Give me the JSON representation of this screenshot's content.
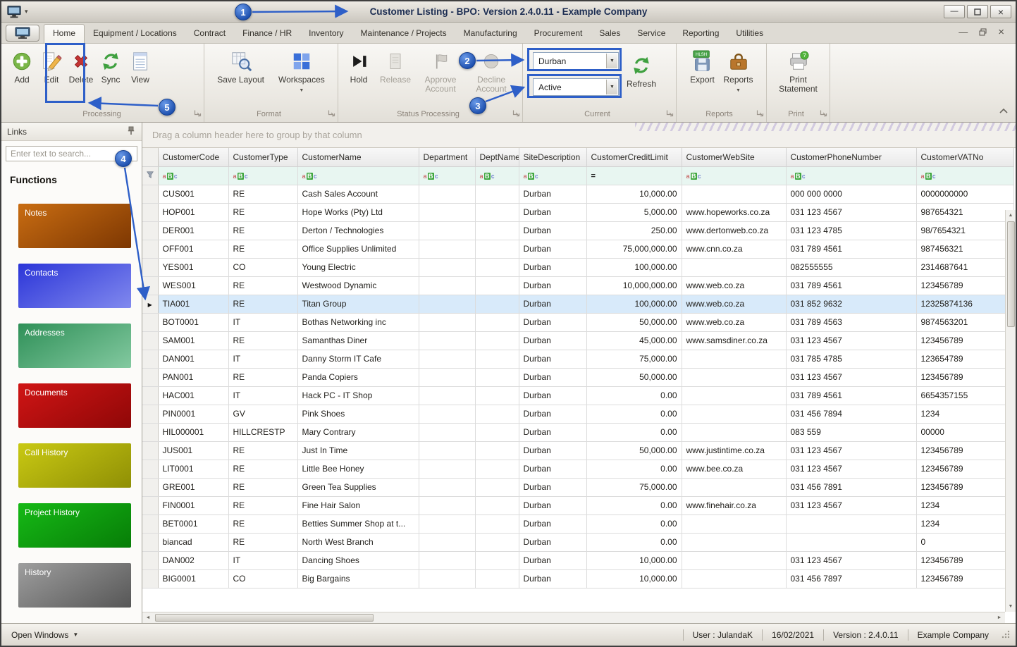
{
  "window": {
    "title": "Customer Listing - BPO: Version 2.4.0.11 - Example Company"
  },
  "ribbon": {
    "tabs": [
      "Home",
      "Equipment / Locations",
      "Contract",
      "Finance / HR",
      "Inventory",
      "Maintenance / Projects",
      "Manufacturing",
      "Procurement",
      "Sales",
      "Service",
      "Reporting",
      "Utilities"
    ],
    "active_tab_index": 0,
    "groups": {
      "processing": {
        "label": "Processing",
        "buttons": {
          "add": "Add",
          "edit": "Edit",
          "delete": "Delete",
          "sync": "Sync",
          "view": "View"
        }
      },
      "format": {
        "label": "Format",
        "buttons": {
          "save_layout": "Save Layout",
          "workspaces": "Workspaces"
        }
      },
      "status_processing": {
        "label": "Status Processing",
        "buttons": {
          "hold": "Hold",
          "release": "Release",
          "approve": "Approve Account",
          "decline": "Decline Account"
        }
      },
      "current": {
        "label": "Current",
        "site_filter": "Durban",
        "status_filter": "Active",
        "refresh": "Refresh"
      },
      "reports": {
        "label": "Reports",
        "buttons": {
          "export": "Export",
          "reports": "Reports"
        },
        "export_badge": "HLSH"
      },
      "print": {
        "label": "Print",
        "buttons": {
          "print_statement": "Print Statement"
        }
      }
    }
  },
  "sidebar": {
    "title": "Links",
    "search_placeholder": "Enter text to search...",
    "section_header": "Functions",
    "items": [
      {
        "label": "Notes",
        "color_from": "#c96d12",
        "color_to": "#7d3702"
      },
      {
        "label": "Contacts",
        "color_from": "#2b35d8",
        "color_to": "#8189ee"
      },
      {
        "label": "Addresses",
        "color_from": "#2f9058",
        "color_to": "#83c9a0"
      },
      {
        "label": "Documents",
        "color_from": "#d01515",
        "color_to": "#8f0707"
      },
      {
        "label": "Call History",
        "color_from": "#c9c913",
        "color_to": "#8f8f05"
      },
      {
        "label": "Project History",
        "color_from": "#16b916",
        "color_to": "#077d07"
      },
      {
        "label": "History",
        "color_from": "#9e9e9e",
        "color_to": "#565656"
      }
    ]
  },
  "grid": {
    "group_hint": "Drag a column header here to group by that column",
    "columns": [
      "CustomerCode",
      "CustomerType",
      "CustomerName",
      "Department",
      "DeptName",
      "SiteDescription",
      "CustomerCreditLimit",
      "CustomerWebSite",
      "CustomerPhoneNumber",
      "CustomerVATNo"
    ],
    "filter_types": [
      "abc",
      "abc",
      "abc",
      "abc",
      "abc",
      "abc",
      "eq",
      "abc",
      "abc",
      "abc"
    ],
    "selected_row_index": 6,
    "rows": [
      [
        "CUS001",
        "RE",
        "Cash Sales Account",
        "",
        "",
        "Durban",
        "10,000.00",
        "",
        "000 000 0000",
        "0000000000"
      ],
      [
        "HOP001",
        "RE",
        "Hope Works (Pty) Ltd",
        "",
        "",
        "Durban",
        "5,000.00",
        "www.hopeworks.co.za",
        "031 123 4567",
        "987654321"
      ],
      [
        "DER001",
        "RE",
        "Derton / Technologies",
        "",
        "",
        "Durban",
        "250.00",
        "www.dertonweb.co.za",
        "031 123 4785",
        "98/7654321"
      ],
      [
        "OFF001",
        "RE",
        "Office Supplies Unlimited",
        "",
        "",
        "Durban",
        "75,000,000.00",
        "www.cnn.co.za",
        "031 789 4561",
        "987456321"
      ],
      [
        "YES001",
        "CO",
        "Young Electric",
        "",
        "",
        "Durban",
        "100,000.00",
        "",
        "082555555",
        "2314687641"
      ],
      [
        "WES001",
        "RE",
        "Westwood Dynamic",
        "",
        "",
        "Durban",
        "10,000,000.00",
        "www.web.co.za",
        "031 789 4561",
        "123456789"
      ],
      [
        "TIA001",
        "RE",
        "Titan Group",
        "",
        "",
        "Durban",
        "100,000.00",
        "www.web.co.za",
        "031 852 9632",
        "12325874136"
      ],
      [
        "BOT0001",
        "IT",
        "Bothas Networking inc",
        "",
        "",
        "Durban",
        "50,000.00",
        "www.web.co.za",
        "031 789 4563",
        "9874563201"
      ],
      [
        "SAM001",
        "RE",
        "Samanthas Diner",
        "",
        "",
        "Durban",
        "45,000.00",
        "www.samsdiner.co.za",
        "031 123 4567",
        "123456789"
      ],
      [
        "DAN001",
        "IT",
        "Danny Storm IT Cafe",
        "",
        "",
        "Durban",
        "75,000.00",
        "",
        "031 785 4785",
        "123654789"
      ],
      [
        "PAN001",
        "RE",
        "Panda Copiers",
        "",
        "",
        "Durban",
        "50,000.00",
        "",
        "031 123 4567",
        "123456789"
      ],
      [
        "HAC001",
        "IT",
        "Hack PC - IT Shop",
        "",
        "",
        "Durban",
        "0.00",
        "",
        "031 789 4561",
        "6654357155"
      ],
      [
        "PIN0001",
        "GV",
        "Pink Shoes",
        "",
        "",
        "Durban",
        "0.00",
        "",
        "031 456 7894",
        "1234"
      ],
      [
        "HIL000001",
        "HILLCRESTP",
        "Mary Contrary",
        "",
        "",
        "Durban",
        "0.00",
        "",
        "083 559",
        "00000"
      ],
      [
        "JUS001",
        "RE",
        "Just In Time",
        "",
        "",
        "Durban",
        "50,000.00",
        "www.justintime.co.za",
        "031 123 4567",
        "123456789"
      ],
      [
        "LIT0001",
        "RE",
        "Little Bee Honey",
        "",
        "",
        "Durban",
        "0.00",
        "www.bee.co.za",
        "031 123 4567",
        "123456789"
      ],
      [
        "GRE001",
        "RE",
        "Green Tea Supplies",
        "",
        "",
        "Durban",
        "75,000.00",
        "",
        "031 456 7891",
        "123456789"
      ],
      [
        "FIN0001",
        "RE",
        "Fine Hair Salon",
        "",
        "",
        "Durban",
        "0.00",
        "www.finehair.co.za",
        "031 123 4567",
        "1234"
      ],
      [
        "BET0001",
        "RE",
        "Betties Summer Shop at t...",
        "",
        "",
        "Durban",
        "0.00",
        "",
        "",
        "1234"
      ],
      [
        "biancad",
        "RE",
        "North West Branch",
        "",
        "",
        "Durban",
        "0.00",
        "",
        "",
        "0"
      ],
      [
        "DAN002",
        "IT",
        "Dancing Shoes",
        "",
        "",
        "Durban",
        "10,000.00",
        "",
        "031 123 4567",
        "123456789"
      ],
      [
        "BIG0001",
        "CO",
        "Big Bargains",
        "",
        "",
        "Durban",
        "10,000.00",
        "",
        "031 456 7897",
        "123456789"
      ]
    ]
  },
  "statusbar": {
    "open_windows": "Open Windows",
    "user": "User : JulandaK",
    "date": "16/02/2021",
    "version": "Version : 2.4.0.11",
    "company": "Example Company"
  },
  "annotations": {
    "color": "#2e5fc8",
    "callouts": [
      "1",
      "2",
      "3",
      "4",
      "5"
    ]
  }
}
